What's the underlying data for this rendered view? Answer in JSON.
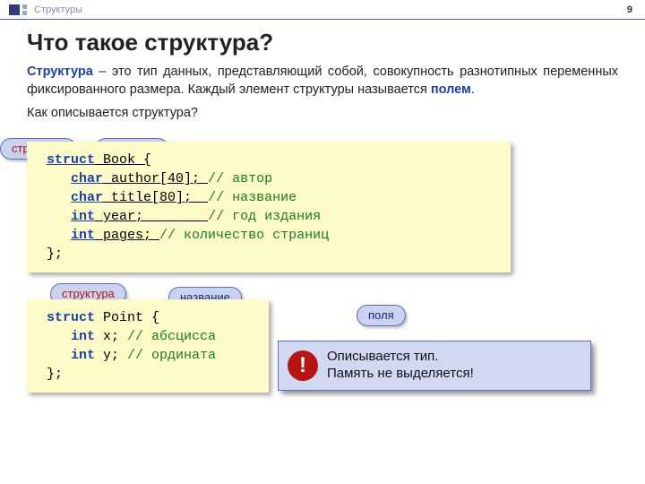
{
  "header": {
    "breadcrumb": "Структуры",
    "page_number": "9"
  },
  "title": "Что такое структура?",
  "intro": {
    "term": "Структура",
    "body": " – это тип данных, представляющий собой, совокупность разнотипных переменных фиксированного размера. Каждый элемент структуры называется ",
    "field_word": "полем",
    "tail": "."
  },
  "subheading": "Как описывается структура?",
  "callouts": {
    "structure": "структура",
    "name": "название",
    "fields": "поля"
  },
  "code1": {
    "l1_kw": "struct",
    "l1_rest": " Book {",
    "l2_kw": "char",
    "l2_rest": " author[40]; ",
    "l2_cm": "// автор",
    "l3_kw": "char",
    "l3_rest": " title[80];  ",
    "l3_cm": "// название",
    "l4_kw": "int",
    "l4_rest": " year;        ",
    "l4_cm": "// год издания",
    "l5_kw": "int",
    "l5_rest": " pages; ",
    "l5_cm": "// количество страниц",
    "l6": "};"
  },
  "code2": {
    "l1_kw": "struct",
    "l1_rest": " Point {",
    "l2_kw": "int",
    "l2_rest": " x; ",
    "l2_cm": "// абсцисса",
    "l3_kw": "int",
    "l3_rest": " y; ",
    "l3_cm": "// ордината",
    "l4": "};"
  },
  "note": {
    "bang": "!",
    "line1": "Описывается тип.",
    "line2": "Память не выделяется!"
  }
}
